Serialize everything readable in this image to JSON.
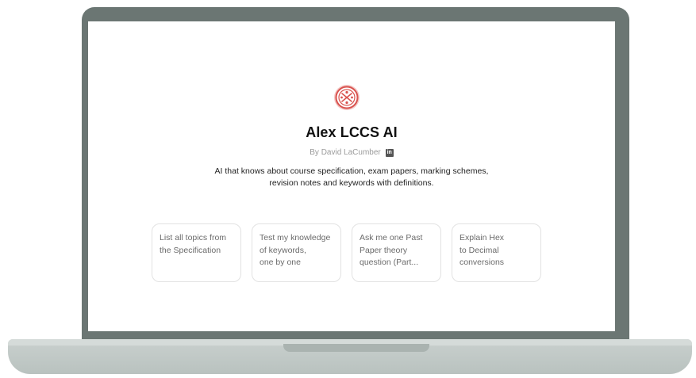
{
  "gpt": {
    "name": "Alex LCCS AI",
    "author": "By David LaCumber",
    "author_link_icon": "linkedin-icon",
    "description": "AI that knows about course specification, exam papers, marking schemes, revision notes and keywords with definitions.",
    "logo_icon": "red-circular-emblem-icon"
  },
  "starters": [
    {
      "label": "List all topics from\nthe Specification"
    },
    {
      "label": "Test my knowledge\nof keywords,\none by one"
    },
    {
      "label": "Ask me one Past\nPaper theory\nquestion (Part..."
    },
    {
      "label": "Explain Hex\nto Decimal\nconversions"
    }
  ],
  "colors": {
    "bezel": "#6b7673",
    "base": "#c1c9c6",
    "logo_red": "#d9534f",
    "card_border": "#e2e2e2",
    "title": "#111111",
    "muted": "#9a9a9a"
  }
}
